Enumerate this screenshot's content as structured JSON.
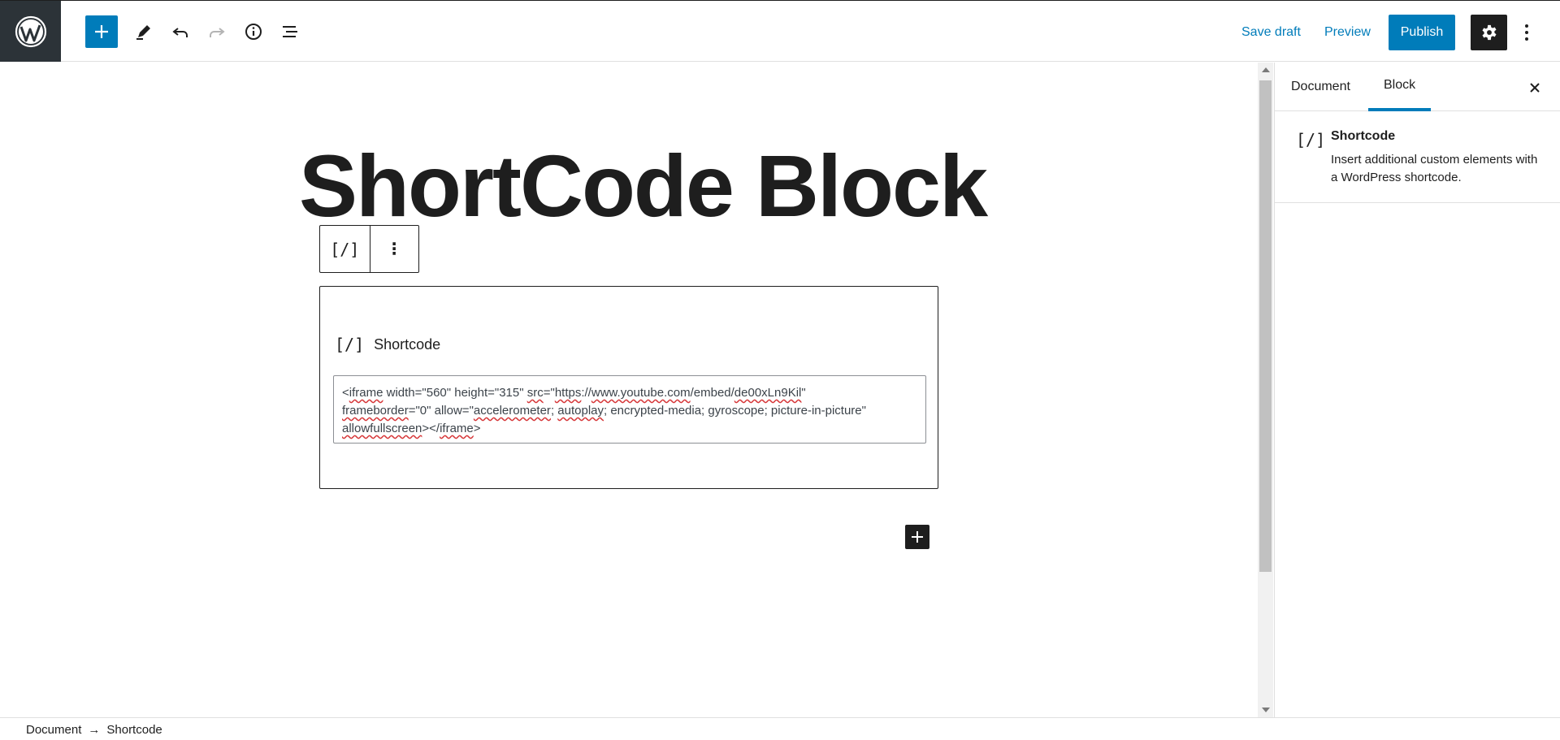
{
  "header": {
    "save_draft": "Save draft",
    "preview": "Preview",
    "publish": "Publish",
    "icons": [
      "wordpress-logo-icon",
      "plus-icon",
      "pencil-icon",
      "undo-icon",
      "redo-icon",
      "info-icon",
      "list-view-icon",
      "gear-icon",
      "kebab-icon"
    ]
  },
  "editor": {
    "post_title": "ShortCode Block",
    "block_toolbar": {
      "block_icon": "[/]",
      "more": "⋮"
    },
    "shortcode_block": {
      "icon": "[/]",
      "label": "Shortcode",
      "content": {
        "line1": [
          "<",
          "iframe",
          " width=\"560\" height=\"315\" ",
          "src",
          "=\"",
          "https",
          "://",
          "www.youtube.com",
          "/embed/",
          "de00xLn9Kil",
          "\""
        ],
        "line2": [
          "frameborder",
          "=\"0\" allow=\"",
          "accelerometer",
          "; ",
          "autoplay",
          "; encrypted-media; gyroscope; picture-in-picture\""
        ],
        "line3": [
          "allowfullscreen",
          "></",
          "iframe",
          ">"
        ]
      }
    }
  },
  "sidebar": {
    "tabs": [
      {
        "label": "Document"
      },
      {
        "label": "Block"
      }
    ],
    "active_tab": "Block",
    "block_card": {
      "icon": "[/]",
      "title": "Shortcode",
      "description": "Insert additional custom elements with a WordPress shortcode."
    }
  },
  "footer": {
    "breadcrumbs": [
      "Document",
      "→",
      "Shortcode"
    ]
  },
  "colors": {
    "accent": "#007cba",
    "dark": "#1e1e1e",
    "logo_bg": "#2c3338",
    "spell_error": "#d63638"
  }
}
